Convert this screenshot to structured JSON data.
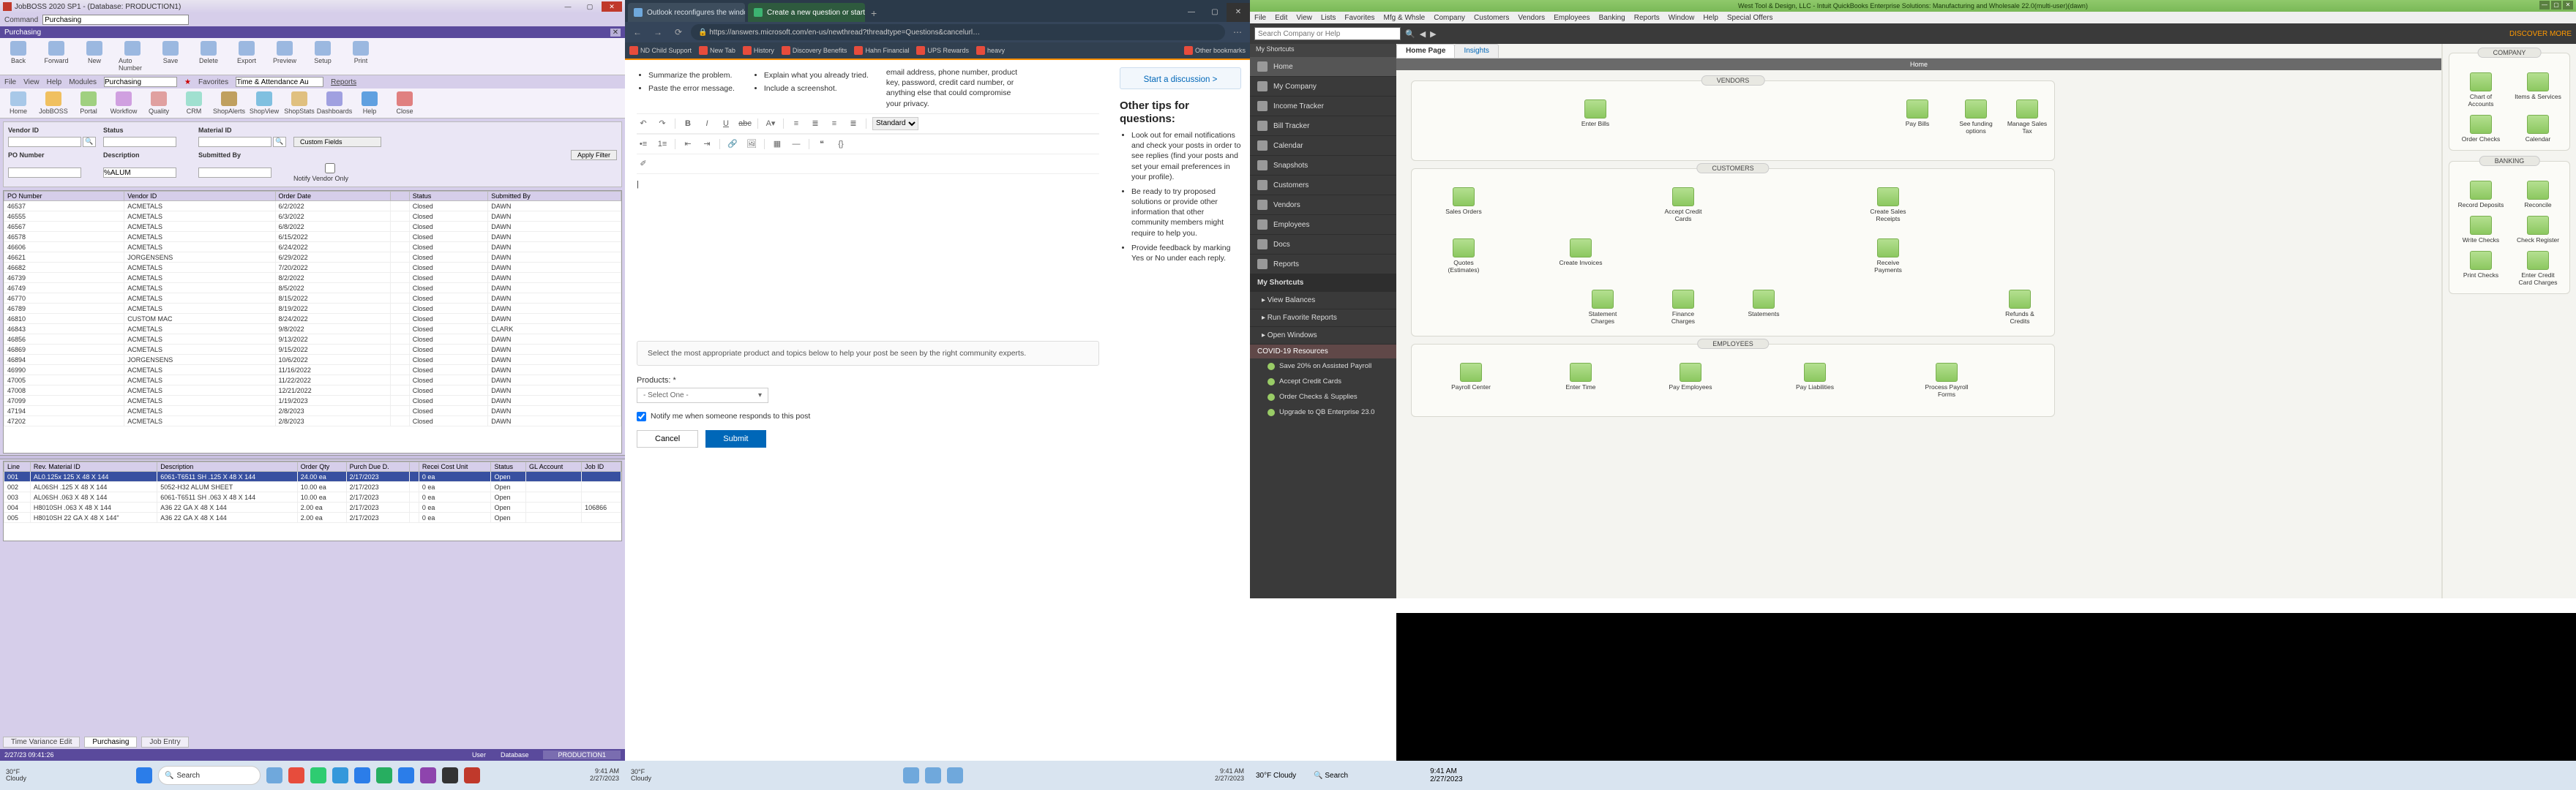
{
  "jobboss": {
    "title": "JobBOSS 2020 SP1 - (Database: PRODUCTION1)",
    "command_label": "Command",
    "command_value": "Purchasing",
    "active_tab": "Purchasing",
    "ribbon1": [
      "Back",
      "Forward",
      "New",
      "Auto Number",
      "Save",
      "Delete",
      "Export",
      "Preview",
      "Setup",
      "Print"
    ],
    "menurow": {
      "file": "File",
      "view": "View",
      "help": "Help",
      "modules": "Modules",
      "modules_val": "Purchasing",
      "favorites": "Favorites",
      "fav_val": "Time & Attendance Au",
      "reports": "Reports"
    },
    "ribbon2": [
      "Home",
      "JobBOSS",
      "Portal",
      "Workflow",
      "Quality",
      "CRM",
      "ShopAlerts",
      "ShopView",
      "ShopStats",
      "Dashboards",
      "Help",
      "Close"
    ],
    "filter": {
      "vendor_id": "Vendor ID",
      "status": "Status",
      "material_id": "Material ID",
      "po_number": "PO Number",
      "description": "Description",
      "submitted_by": "Submitted By",
      "custom": "Custom Fields",
      "desc_val": "%ALUM",
      "apply": "Apply Filter",
      "notify": "Notify Vendor Only"
    },
    "grid_cols": [
      "PO Number",
      "Vendor ID",
      "Order Date",
      "",
      "Status",
      "Submitted By"
    ],
    "grid_rows": [
      [
        "46537",
        "ACMETALS",
        "6/2/2022",
        "",
        "Closed",
        "DAWN"
      ],
      [
        "46555",
        "ACMETALS",
        "6/3/2022",
        "",
        "Closed",
        "DAWN"
      ],
      [
        "46567",
        "ACMETALS",
        "6/8/2022",
        "",
        "Closed",
        "DAWN"
      ],
      [
        "46578",
        "ACMETALS",
        "6/15/2022",
        "",
        "Closed",
        "DAWN"
      ],
      [
        "46606",
        "ACMETALS",
        "6/24/2022",
        "",
        "Closed",
        "DAWN"
      ],
      [
        "46621",
        "JORGENSENS",
        "6/29/2022",
        "",
        "Closed",
        "DAWN"
      ],
      [
        "46682",
        "ACMETALS",
        "7/20/2022",
        "",
        "Closed",
        "DAWN"
      ],
      [
        "46739",
        "ACMETALS",
        "8/2/2022",
        "",
        "Closed",
        "DAWN"
      ],
      [
        "46749",
        "ACMETALS",
        "8/5/2022",
        "",
        "Closed",
        "DAWN"
      ],
      [
        "46770",
        "ACMETALS",
        "8/15/2022",
        "",
        "Closed",
        "DAWN"
      ],
      [
        "46789",
        "ACMETALS",
        "8/19/2022",
        "",
        "Closed",
        "DAWN"
      ],
      [
        "46810",
        "CUSTOM MAC",
        "8/24/2022",
        "",
        "Closed",
        "DAWN"
      ],
      [
        "46843",
        "ACMETALS",
        "9/8/2022",
        "",
        "Closed",
        "CLARK"
      ],
      [
        "46856",
        "ACMETALS",
        "9/13/2022",
        "",
        "Closed",
        "DAWN"
      ],
      [
        "46869",
        "ACMETALS",
        "9/15/2022",
        "",
        "Closed",
        "DAWN"
      ],
      [
        "46894",
        "JORGENSENS",
        "10/6/2022",
        "",
        "Closed",
        "DAWN"
      ],
      [
        "46990",
        "ACMETALS",
        "11/16/2022",
        "",
        "Closed",
        "DAWN"
      ],
      [
        "47005",
        "ACMETALS",
        "11/22/2022",
        "",
        "Closed",
        "DAWN"
      ],
      [
        "47008",
        "ACMETALS",
        "12/21/2022",
        "",
        "Closed",
        "DAWN"
      ],
      [
        "47099",
        "ACMETALS",
        "1/19/2023",
        "",
        "Closed",
        "DAWN"
      ],
      [
        "47194",
        "ACMETALS",
        "2/8/2023",
        "",
        "Closed",
        "DAWN"
      ],
      [
        "47202",
        "ACMETALS",
        "2/8/2023",
        "",
        "Closed",
        "DAWN"
      ]
    ],
    "lines_cols": [
      "Line",
      "Rev. Material ID",
      "Description",
      "Order Qty",
      "Purch Due D.",
      "",
      "Recei Cost Unit",
      "Status",
      "GL Account",
      "Job ID"
    ],
    "lines_rows": [
      [
        "001",
        "AL0.125x 125 X 48 X 144",
        "6061-T6511 SH .125 X 48 X 144",
        "24.00  ea",
        "2/17/2023",
        "",
        "0  ea",
        "Open",
        "",
        ""
      ],
      [
        "002",
        "AL06SH .125 X 48 X 144",
        "5052-H32 ALUM SHEET",
        "10.00  ea",
        "2/17/2023",
        "",
        "0  ea",
        "Open",
        "",
        ""
      ],
      [
        "003",
        "AL06SH .063 X 48 X 144",
        "6061-T6511 SH .063 X 48 X 144",
        "10.00  ea",
        "2/17/2023",
        "",
        "0  ea",
        "Open",
        "",
        ""
      ],
      [
        "004",
        "H8010SH .063 X 48 X 144",
        "A36 22 GA X 48 X 144",
        "2.00  ea",
        "2/17/2023",
        "",
        "0  ea",
        "Open",
        "",
        "106866"
      ],
      [
        "005",
        "H8010SH 22 GA X 48 X 144\"",
        "A36 22 GA X 48 X 144",
        "2.00  ea",
        "2/17/2023",
        "",
        "0  ea",
        "Open",
        "",
        ""
      ]
    ],
    "bottom_tabs": [
      "Time Variance Edit",
      "Purchasing",
      "Job Entry"
    ],
    "statusbar": {
      "time": "2/27/23 09:41:26",
      "user": "User",
      "db": "Database",
      "dbval": "PRODUCTION1"
    },
    "taskbar": {
      "temp": "30°F",
      "cond": "Cloudy",
      "search": "Search",
      "time": "9:41 AM",
      "date": "2/27/2023"
    }
  },
  "edge": {
    "tabs": [
      {
        "title": "Outlook reconfigures the windo…"
      },
      {
        "title": "Create a new question or start a…"
      }
    ],
    "url": "https://answers.microsoft.com/en-us/newthread?threadtype=Questions&cancelurl…",
    "bookmarks": [
      "ND Child Support",
      "New Tab",
      "History",
      "Discovery Benefits",
      "Hahn Financial",
      "UPS Rewards",
      "heavy",
      "Other bookmarks"
    ],
    "tips_left": [
      "Summarize the problem.",
      "Paste the error message.",
      "Explain what you already tried.",
      "Include a screenshot.",
      "email address, phone number, product key, password, credit card number, or anything else that could compromise your privacy."
    ],
    "added": "Select the most appropriate product and topics below to help your post be seen by the right community experts.",
    "products_label": "Products: *",
    "select_one": "- Select One -",
    "notify": "Notify me when someone responds to this post",
    "cancel": "Cancel",
    "submit": "Submit",
    "rte_style": "Standard",
    "side": {
      "start": "Start a discussion >",
      "hdr": "Other tips for questions:",
      "items": [
        "Look out for email notifications and check your posts in order to see replies (find your posts and set your email preferences in your profile).",
        "Be ready to try proposed solutions or provide other information that other community members might require to help you.",
        "Provide feedback by marking Yes or No under each reply."
      ]
    },
    "taskbar": {
      "temp": "30°F",
      "cond": "Cloudy",
      "time": "9:41 AM",
      "date": "2/27/2023"
    }
  },
  "qb": {
    "title": "West Tool & Design, LLC - Intuit QuickBooks Enterprise Solutions: Manufacturing and Wholesale 22.0(multi-user)(dawn)",
    "menus": [
      "File",
      "Edit",
      "View",
      "Lists",
      "Favorites",
      "Mfg & Whsle",
      "Company",
      "Customers",
      "Vendors",
      "Employees",
      "Banking",
      "Reports",
      "Window",
      "Help",
      "Special Offers"
    ],
    "search": "Search Company or Help",
    "shortcuts_hdr": "My Shortcuts",
    "sidebar": [
      "Home",
      "My Company",
      "Income Tracker",
      "Bill Tracker",
      "Calendar",
      "Snapshots",
      "Customers",
      "Vendors",
      "Employees",
      "Docs",
      "Reports"
    ],
    "sb_subhdr": "My Shortcuts",
    "sb_sub": [
      "View Balances",
      "Run Favorite Reports",
      "Open Windows"
    ],
    "covid": "COVID-19 Resources",
    "covid_items": [
      "Save 20% on Assisted Payroll",
      "Accept Credit Cards",
      "Order Checks & Supplies",
      "Upgrade to QB Enterprise 23.0"
    ],
    "tabs": [
      "Home Page",
      "Insights"
    ],
    "subbar": "Home",
    "sections": {
      "vendors": "VENDORS",
      "customers": "CUSTOMERS",
      "employees": "EMPLOYEES",
      "company": "COMPANY",
      "banking": "BANKING"
    },
    "nodes": {
      "enter_bills": "Enter Bills",
      "pay_bills": "Pay Bills",
      "see_funding": "See funding options",
      "manage_sales_tax": "Manage Sales Tax",
      "sales_orders": "Sales Orders",
      "accept_cc": "Accept Credit Cards",
      "create_sr": "Create Sales Receipts",
      "quotes": "Quotes (Estimates)",
      "create_inv": "Create Invoices",
      "receive_pay": "Receive Payments",
      "stmt_charges": "Statement Charges",
      "finance_charges": "Finance Charges",
      "statements": "Statements",
      "refunds": "Refunds & Credits",
      "payroll_center": "Payroll Center",
      "enter_time": "Enter Time",
      "pay_emp": "Pay Employees",
      "pay_liab": "Pay Liabilities",
      "proc_pf": "Process Payroll Forms",
      "coa": "Chart of Accounts",
      "items": "Items & Services",
      "order_checks": "Order Checks",
      "calendar": "Calendar",
      "rec_dep": "Record Deposits",
      "reconcile": "Reconcile",
      "write_checks": "Write Checks",
      "check_reg": "Check Register",
      "print_checks": "Print Checks",
      "enter_cc": "Enter Credit Card Charges"
    },
    "taskbar": {
      "temp": "30°F",
      "cond": "Cloudy",
      "search": "Search",
      "time": "9:41 AM",
      "date": "2/27/2023"
    },
    "discover": "DISCOVER MORE"
  }
}
